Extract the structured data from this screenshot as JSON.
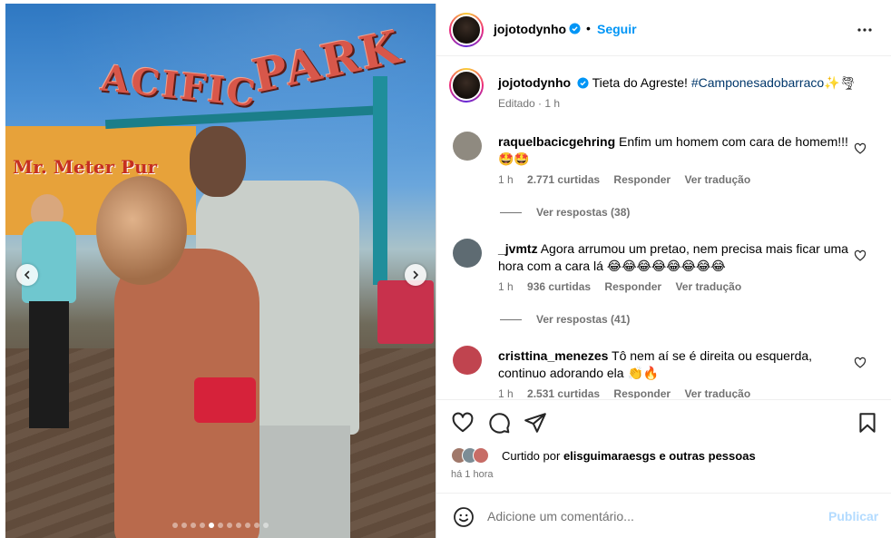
{
  "post": {
    "author": "jojotodynho",
    "follow_label": "Seguir",
    "separator": "•",
    "caption_text": "Tieta do Agreste!",
    "caption_hashtag": "#Camponesadobarraco",
    "caption_emojis": "✨🌪",
    "caption_meta": "Editado · 1 h"
  },
  "media": {
    "sign_left": "ACIFIC",
    "sign_right": "PARK",
    "shop_sign": "Mr. Meter Pur",
    "carousel_total": 11,
    "carousel_active": 5
  },
  "comments": [
    {
      "username": "raquelbacicgehring",
      "text": "Enfim um homem com cara de homem!!!",
      "emojis": "🤩🤩",
      "time": "1 h",
      "likes": "2.771 curtidas",
      "reply": "Responder",
      "translate": "Ver tradução",
      "view_replies": "Ver respostas (38)",
      "avatar_color": "#8f8a80"
    },
    {
      "username": "_jvmtz",
      "text": "Agora arrumou um pretao, nem precisa mais ficar uma hora com a cara lá",
      "emojis": "😂😂😂😂😂😂😂😂",
      "time": "1 h",
      "likes": "936 curtidas",
      "reply": "Responder",
      "translate": "Ver tradução",
      "view_replies": "Ver respostas (41)",
      "avatar_color": "#5e6b72"
    },
    {
      "username": "cristtina_menezes",
      "text": "Tô nem aí se é direita ou esquerda, continuo adorando ela",
      "emojis": "👏🔥",
      "time": "1 h",
      "likes": "2.531 curtidas",
      "reply": "Responder",
      "translate": "Ver tradução",
      "avatar_color": "#c0444f"
    }
  ],
  "likes": {
    "prefix": "Curtido por",
    "user": "elisguimaraesgs",
    "suffix": "e outras pessoas",
    "time_ago": "há 1 hora"
  },
  "composer": {
    "placeholder": "Adicione um comentário...",
    "publish_label": "Publicar"
  },
  "colors": {
    "link_blue": "#0095f6",
    "hashtag": "#00376b",
    "muted": "#737373",
    "publish_disabled": "#b3dbff"
  },
  "icons": {
    "nav_prev": "chevron-left-icon",
    "nav_next": "chevron-right-icon",
    "more": "more-horizontal-icon",
    "like": "heart-icon",
    "comment": "comment-icon",
    "share": "send-icon",
    "save": "bookmark-icon",
    "emoji": "smiley-icon",
    "verified": "verified-badge-icon"
  }
}
